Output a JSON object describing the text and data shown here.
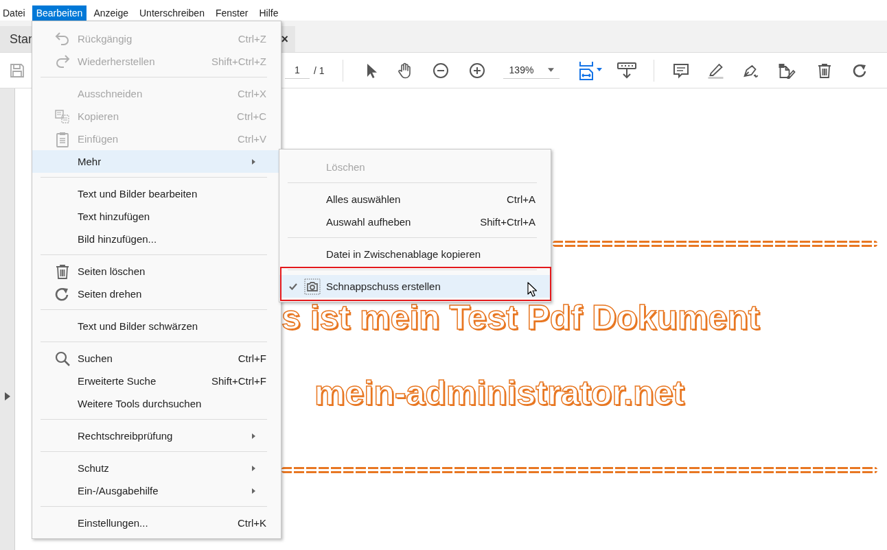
{
  "menubar": [
    {
      "label": "Datei",
      "selected": false
    },
    {
      "label": "Bearbeiten",
      "selected": true
    },
    {
      "label": "Anzeige",
      "selected": false
    },
    {
      "label": "Unterschreiben",
      "selected": false
    },
    {
      "label": "Fenster",
      "selected": false
    },
    {
      "label": "Hilfe",
      "selected": false
    }
  ],
  "tab": {
    "label": "Star",
    "close": "×"
  },
  "toolbar": {
    "page": "1",
    "page_total": "/ 1",
    "zoom": "139%"
  },
  "document": {
    "lines": [
      "s ist mein Test Pdf Dokument",
      "mein-administrator.net"
    ]
  },
  "menu": {
    "items": [
      {
        "kind": "item",
        "label": "Rückgängig",
        "shortcut": "Ctrl+Z",
        "disabled": true,
        "highlighted": false
      },
      {
        "kind": "item",
        "label": "Wiederherstellen",
        "shortcut": "Shift+Ctrl+Z",
        "disabled": true,
        "highlighted": false
      },
      {
        "kind": "separator"
      },
      {
        "kind": "item",
        "label": "Ausschneiden",
        "shortcut": "Ctrl+X",
        "disabled": true,
        "highlighted": false
      },
      {
        "kind": "item",
        "label": "Kopieren",
        "shortcut": "Ctrl+C",
        "disabled": true,
        "highlighted": false
      },
      {
        "kind": "item",
        "label": "Einfügen",
        "shortcut": "Ctrl+V",
        "disabled": true,
        "highlighted": false
      },
      {
        "kind": "submenu",
        "label": "Mehr",
        "disabled": false,
        "highlighted": true
      },
      {
        "kind": "separator"
      },
      {
        "kind": "item",
        "label": "Text und Bilder bearbeiten",
        "disabled": false,
        "highlighted": false
      },
      {
        "kind": "item",
        "label": "Text hinzufügen",
        "disabled": false,
        "highlighted": false
      },
      {
        "kind": "item",
        "label": "Bild hinzufügen...",
        "disabled": false,
        "highlighted": false
      },
      {
        "kind": "separator"
      },
      {
        "kind": "item",
        "label": "Seiten löschen",
        "disabled": false,
        "highlighted": false
      },
      {
        "kind": "item",
        "label": "Seiten drehen",
        "disabled": false,
        "highlighted": false
      },
      {
        "kind": "separator"
      },
      {
        "kind": "item",
        "label": "Text und Bilder schwärzen",
        "disabled": false,
        "highlighted": false
      },
      {
        "kind": "separator"
      },
      {
        "kind": "item",
        "label": "Suchen",
        "shortcut": "Ctrl+F",
        "disabled": false,
        "highlighted": false
      },
      {
        "kind": "item",
        "label": "Erweiterte Suche",
        "shortcut": "Shift+Ctrl+F",
        "disabled": false,
        "highlighted": false
      },
      {
        "kind": "item",
        "label": "Weitere Tools durchsuchen",
        "disabled": false,
        "highlighted": false
      },
      {
        "kind": "separator"
      },
      {
        "kind": "submenu",
        "label": "Rechtschreibprüfung",
        "disabled": false,
        "highlighted": false
      },
      {
        "kind": "separator"
      },
      {
        "kind": "submenu",
        "label": "Schutz",
        "disabled": false,
        "highlighted": false
      },
      {
        "kind": "submenu",
        "label": "Ein-/Ausgabehilfe",
        "disabled": false,
        "highlighted": false
      },
      {
        "kind": "separator"
      },
      {
        "kind": "item",
        "label": "Einstellungen...",
        "shortcut": "Ctrl+K",
        "disabled": false,
        "highlighted": false
      }
    ]
  },
  "submenu": {
    "items": [
      {
        "kind": "item",
        "label": "Löschen",
        "disabled": true,
        "highlighted": false,
        "checked": false
      },
      {
        "kind": "separator"
      },
      {
        "kind": "item",
        "label": "Alles auswählen",
        "shortcut": "Ctrl+A",
        "disabled": false,
        "highlighted": false,
        "checked": false
      },
      {
        "kind": "item",
        "label": "Auswahl aufheben",
        "shortcut": "Shift+Ctrl+A",
        "disabled": false,
        "highlighted": false,
        "checked": false
      },
      {
        "kind": "separator"
      },
      {
        "kind": "item",
        "label": "Datei in Zwischenablage kopieren",
        "disabled": false,
        "highlighted": false,
        "checked": false
      },
      {
        "kind": "separator"
      },
      {
        "kind": "item",
        "label": "Schnappschuss erstellen",
        "disabled": false,
        "highlighted": true,
        "checked": true
      }
    ]
  }
}
